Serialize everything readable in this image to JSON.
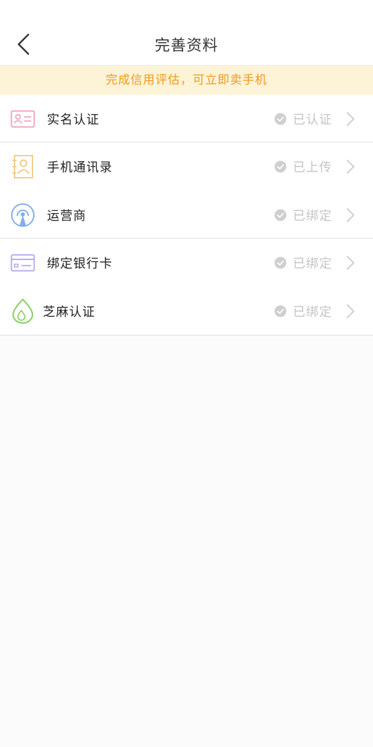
{
  "header": {
    "title": "完善资料",
    "back_icon": "chevron-left-icon"
  },
  "notice": {
    "text": "完成信用评估，可立即卖手机",
    "color": "#f09a1a",
    "background": "#fdf3d6"
  },
  "items": [
    {
      "label": "实名认证",
      "status": "已认证",
      "icon": "id-card-icon",
      "icon_color": "#f0a6c0"
    },
    {
      "label": "手机通讯录",
      "status": "已上传",
      "icon": "contacts-icon",
      "icon_color": "#f4cd8e"
    },
    {
      "label": "运营商",
      "status": "已绑定",
      "icon": "signal-tower-icon",
      "icon_color": "#7fb0ee"
    },
    {
      "label": "绑定银行卡",
      "status": "已绑定",
      "icon": "bank-card-icon",
      "icon_color": "#b7aef0"
    },
    {
      "label": "芝麻认证",
      "status": "已绑定",
      "icon": "sesame-seed-icon",
      "icon_color": "#8fd16a"
    }
  ],
  "status_color": "#c4c4c4"
}
